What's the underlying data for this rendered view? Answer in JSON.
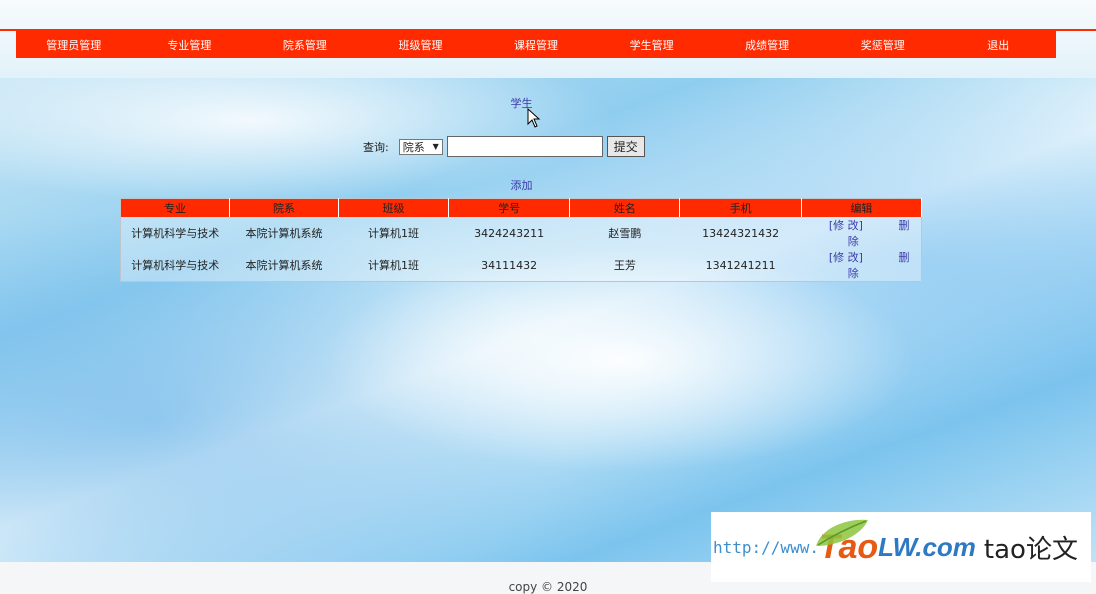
{
  "nav": {
    "items": [
      "管理员管理",
      "专业管理",
      "院系管理",
      "班级管理",
      "课程管理",
      "学生管理",
      "成绩管理",
      "奖惩管理",
      "退出"
    ]
  },
  "page": {
    "title": "学生",
    "search_label": "查询:",
    "select_value": "院系",
    "search_value": "",
    "submit_label": "提交",
    "add_label": "添加"
  },
  "table": {
    "headers": [
      "专业",
      "院系",
      "班级",
      "学号",
      "姓名",
      "手机",
      "编辑"
    ],
    "rows": [
      {
        "major": "计算机科学与技术",
        "dept": "本院计算机系统",
        "class": "计算机1班",
        "id": "3424243211",
        "name": "赵雪鹏",
        "phone": "13424321432",
        "edit": "[修 改]",
        "del": "删除"
      },
      {
        "major": "计算机科学与技术",
        "dept": "本院计算机系统",
        "class": "计算机1班",
        "id": "34111432",
        "name": "王芳",
        "phone": "1341241211",
        "edit": "[修 改]",
        "del": "删除"
      }
    ]
  },
  "footer": {
    "text": "copy © 2020"
  },
  "watermark": {
    "url": "http://www.",
    "brand_a": "Tao",
    "brand_b": "LW.com",
    "brand_c": "tao论文"
  },
  "colors": {
    "nav_bg": "#ff2a00",
    "link": "#3a3aa8"
  }
}
